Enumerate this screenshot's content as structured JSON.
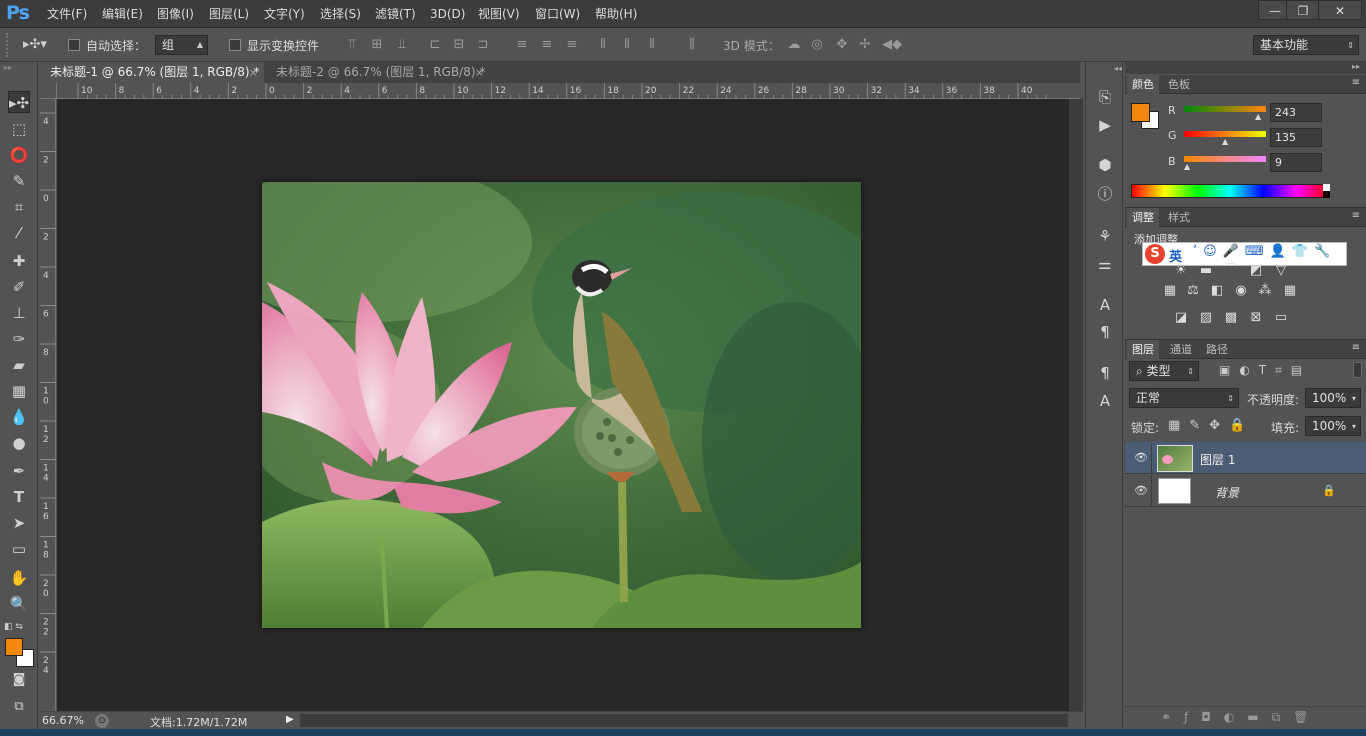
{
  "app": {
    "logo": "Ps"
  },
  "menubar": {
    "items": [
      "文件(F)",
      "编辑(E)",
      "图像(I)",
      "图层(L)",
      "文字(Y)",
      "选择(S)",
      "滤镜(T)",
      "3D(D)",
      "视图(V)",
      "窗口(W)",
      "帮助(H)"
    ]
  },
  "window_controls": {
    "minimize": "—",
    "restore": "❐",
    "close": "✕"
  },
  "options": {
    "auto_select_label": "自动选择：",
    "auto_select_value": "组",
    "show_transform_label": "显示变换控件",
    "mode_3d_label": "3D 模式：",
    "workspace": "基本功能"
  },
  "tabs": [
    {
      "label": "未标题-1 @ 66.7% (图层 1, RGB/8) *",
      "close": "×",
      "active": true
    },
    {
      "label": "未标题-2 @ 66.7% (图层 1, RGB/8) *",
      "close": "×",
      "active": false
    }
  ],
  "ruler_top": [
    "10",
    "8",
    "6",
    "4",
    "2",
    "0",
    "2",
    "4",
    "6",
    "8",
    "10",
    "12",
    "14",
    "16",
    "18",
    "20",
    "22",
    "24",
    "26",
    "28",
    "30",
    "32",
    "34",
    "36",
    "38",
    "40"
  ],
  "ruler_left": [
    "4",
    "2",
    "0",
    "2",
    "4",
    "6",
    "8",
    "1 0",
    "1 2",
    "1 4",
    "1 6",
    "1 8",
    "2 0",
    "2 2",
    "2 4"
  ],
  "status": {
    "zoom": "66.67%",
    "doc": "文档:1.72M/1.72M"
  },
  "color_panel": {
    "tabs": [
      "颜色",
      "色板"
    ],
    "r_label": "R",
    "g_label": "G",
    "b_label": "B",
    "r": "243",
    "g": "135",
    "b": "9",
    "foreground": "#f38709",
    "background": "#ffffff"
  },
  "adjust_panel": {
    "tabs": [
      "调整",
      "样式"
    ],
    "add_label": "添加调整",
    "ime_label": "英"
  },
  "layers_panel": {
    "tabs": [
      "图层",
      "通道",
      "路径"
    ],
    "filter_kind": "类型",
    "blend_mode": "正常",
    "opacity_label": "不透明度:",
    "opacity": "100%",
    "lock_label": "锁定:",
    "fill_label": "填充:",
    "fill": "100%",
    "layers": [
      {
        "name": "图层 1",
        "selected": true,
        "visible": true,
        "locked": false
      },
      {
        "name": "背景",
        "selected": false,
        "visible": true,
        "locked": true
      }
    ]
  },
  "icons": {
    "move": "move-tool-icon",
    "marquee": "marquee-tool-icon",
    "lasso": "lasso-tool-icon",
    "eye": "eye-icon",
    "lock": "lock-icon"
  }
}
